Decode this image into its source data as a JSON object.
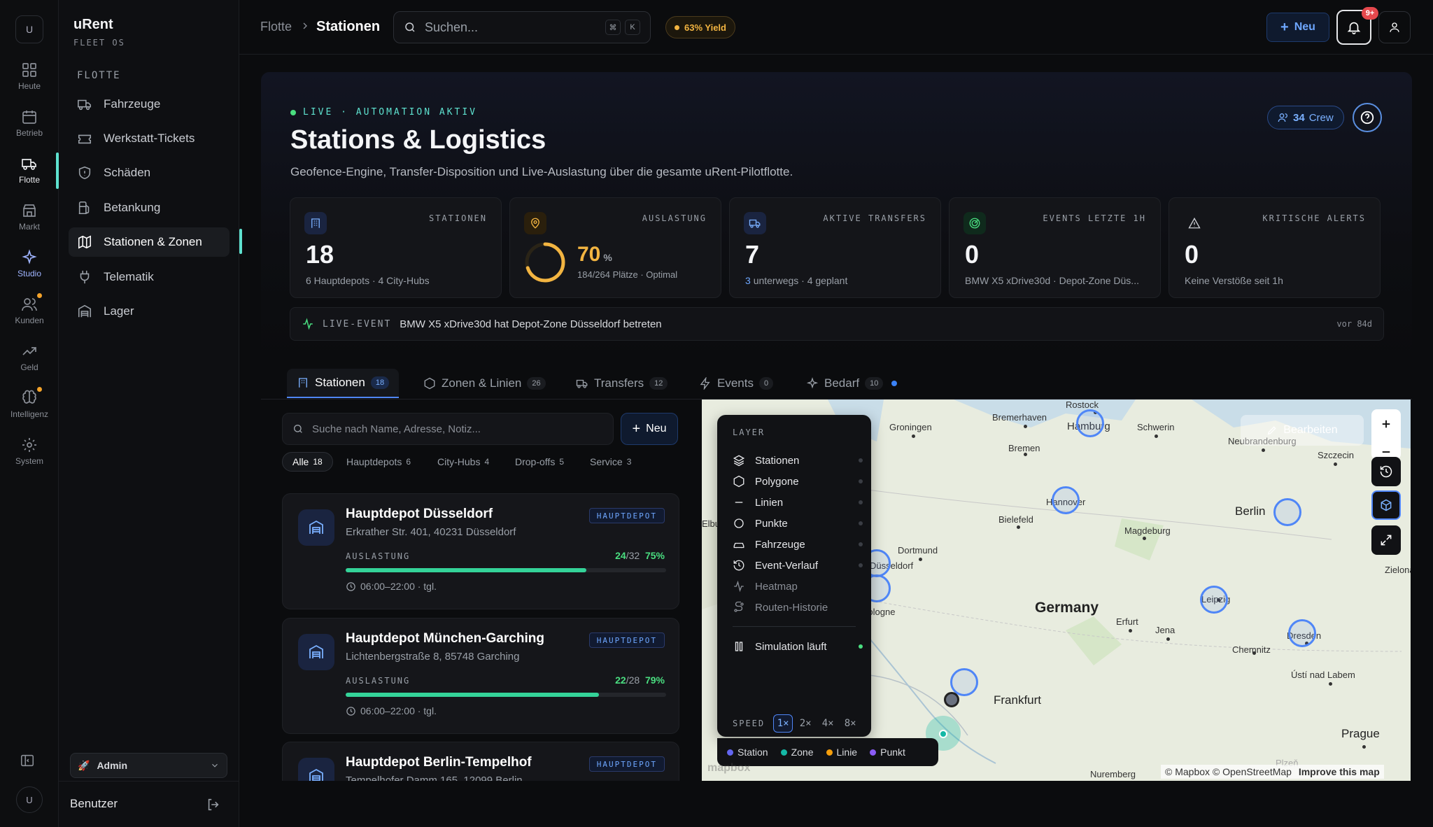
{
  "rail": {
    "avatar": "U",
    "items": [
      {
        "label": "Heute"
      },
      {
        "label": "Betrieb"
      },
      {
        "label": "Flotte"
      },
      {
        "label": "Markt"
      },
      {
        "label": "Studio"
      },
      {
        "label": "Kunden"
      },
      {
        "label": "Geld"
      },
      {
        "label": "Intelligenz"
      },
      {
        "label": "System"
      }
    ],
    "user": "U",
    "colors": {
      "active_accent": "#5ee1cf",
      "notify_dot": "#f4a32a"
    }
  },
  "sidebar": {
    "brand": "uRent",
    "brand_sub": "FLEET OS",
    "section": "FLOTTE",
    "items": [
      {
        "label": "Fahrzeuge"
      },
      {
        "label": "Werkstatt-Tickets"
      },
      {
        "label": "Schäden"
      },
      {
        "label": "Betankung"
      },
      {
        "label": "Stationen & Zonen"
      },
      {
        "label": "Telematik"
      },
      {
        "label": "Lager"
      }
    ],
    "role": "Admin",
    "footer": "Benutzer"
  },
  "topbar": {
    "breadcrumb": [
      "Flotte",
      "Stationen"
    ],
    "search_placeholder": "Suchen...",
    "kbd": [
      "⌘",
      "K"
    ],
    "yield": "63% Yield",
    "new_label": "Neu",
    "notif_badge": "9+"
  },
  "hero": {
    "live": "LIVE · AUTOMATION AKTIV",
    "title": "Stations & Logistics",
    "desc": "Geofence-Engine, Transfer-Disposition und Live-Auslastung über die gesamte uRent-Pilotflotte.",
    "crew_count": "34",
    "crew_label": "Crew"
  },
  "kpis": [
    {
      "label": "STATIONEN",
      "value": "18",
      "sub": "6 Hauptdepots · 4 City-Hubs"
    },
    {
      "label": "AUSLASTUNG",
      "value": "70",
      "unit": "%",
      "sub": "184/264 Plätze · Optimal",
      "fraction": 0.7
    },
    {
      "label": "AKTIVE TRANSFERS",
      "value": "7",
      "sub_num": "3",
      "sub": "unterwegs · 4 geplant"
    },
    {
      "label": "EVENTS LETZTE 1H",
      "value": "0",
      "sub": "BMW X5 xDrive30d · Depot-Zone Düs..."
    },
    {
      "label": "KRITISCHE ALERTS",
      "value": "0",
      "sub": "Keine Verstöße seit 1h"
    }
  ],
  "ticker": {
    "label": "LIVE-EVENT",
    "text": "BMW X5 xDrive30d hat Depot-Zone Düsseldorf betreten",
    "time": "vor 84d"
  },
  "tabs": [
    {
      "label": "Stationen",
      "count": "18"
    },
    {
      "label": "Zonen & Linien",
      "count": "26"
    },
    {
      "label": "Transfers",
      "count": "12"
    },
    {
      "label": "Events",
      "count": "0"
    },
    {
      "label": "Bedarf",
      "count": "10"
    }
  ],
  "list": {
    "search_placeholder": "Suche nach Name, Adresse, Notiz...",
    "new_label": "Neu",
    "filters": [
      {
        "label": "Alle",
        "count": "18"
      },
      {
        "label": "Hauptdepots",
        "count": "6"
      },
      {
        "label": "City-Hubs",
        "count": "4"
      },
      {
        "label": "Drop-offs",
        "count": "5"
      },
      {
        "label": "Service",
        "count": "3"
      }
    ],
    "cards": [
      {
        "name": "Hauptdepot Düsseldorf",
        "addr": "Erkrather Str. 401, 40231 Düsseldorf",
        "tag": "HAUPTDEPOT",
        "aus_label": "AUSLASTUNG",
        "used": "24",
        "total": "/32",
        "pct": "75%",
        "fraction": 0.75,
        "hours": "06:00–22:00 · tgl."
      },
      {
        "name": "Hauptdepot München-Garching",
        "addr": "Lichtenbergstraße 8, 85748 Garching",
        "tag": "HAUPTDEPOT",
        "aus_label": "AUSLASTUNG",
        "used": "22",
        "total": "/28",
        "pct": "79%",
        "fraction": 0.79,
        "hours": "06:00–22:00 · tgl."
      },
      {
        "name": "Hauptdepot Berlin-Tempelhof",
        "addr": "Tempelhofer Damm 165, 12099 Berlin",
        "tag": "HAUPTDEPOT",
        "aus_label": "AUSLASTUNG",
        "used": "",
        "total": "",
        "pct": "",
        "fraction": 0,
        "hours": ""
      }
    ]
  },
  "map": {
    "layer_title": "LAYER",
    "layers": [
      "Stationen",
      "Polygone",
      "Linien",
      "Punkte",
      "Fahrzeuge",
      "Event-Verlauf",
      "Heatmap",
      "Routen-Historie"
    ],
    "simulation": "Simulation läuft",
    "speed_label": "SPEED",
    "speeds": [
      "1×",
      "2×",
      "4×",
      "8×"
    ],
    "legend": [
      {
        "label": "Station",
        "color": "#6366f1"
      },
      {
        "label": "Zone",
        "color": "#14b8a6"
      },
      {
        "label": "Linie",
        "color": "#f59e0b"
      },
      {
        "label": "Punkt",
        "color": "#8b5cf6"
      }
    ],
    "edit_label": "Bearbeiten",
    "cities": [
      "Rostock",
      "Bremerhaven",
      "Hamburg",
      "Schwerin",
      "Groningen",
      "Bremen",
      "Neubrandenburg",
      "Szczecin",
      "Hannover",
      "Berlin",
      "Bielefeld",
      "Magdeburg",
      "Dortmund",
      "Düsseldorf",
      "Cologne",
      "Germany",
      "Erfurt",
      "Jena",
      "Leipzig",
      "Dresden",
      "Chemnitz",
      "Ústí nad Labem",
      "Frankfurt",
      "Prague",
      "Nuremberg",
      "Plzeň",
      "Zielona",
      "Elburg"
    ],
    "attribution": "© Mapbox © OpenStreetMap",
    "improve": "Improve this map",
    "mapbox": "mapbox"
  }
}
